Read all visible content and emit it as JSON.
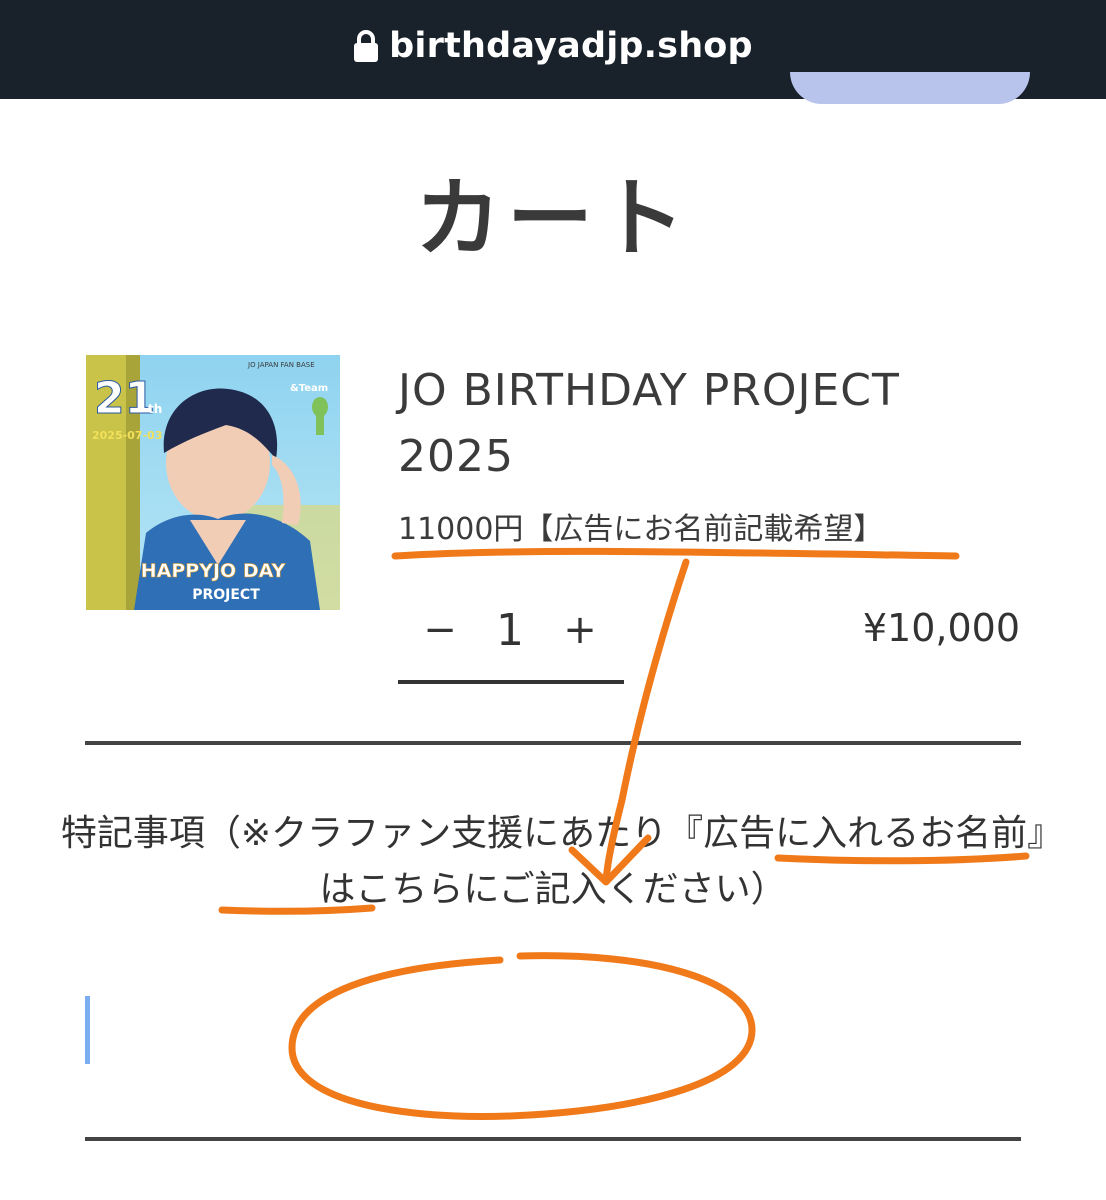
{
  "browser": {
    "url": "birthdayadjp.shop",
    "lock_icon": "lock-icon"
  },
  "page": {
    "title": "カート"
  },
  "cart_item": {
    "thumbnail": {
      "number": "21",
      "suffix": "th",
      "date": "2025-07-03",
      "fanbase": "JO JAPAN FAN BASE",
      "brand": "&Team",
      "line1": "HAPPYJO DAY",
      "line2": "PROJECT"
    },
    "name": "JO BIRTHDAY PROJECT 2025",
    "variant": "11000円【広告にお名前記載希望】",
    "quantity": "1",
    "minus_symbol": "−",
    "plus_symbol": "+",
    "price": "¥10,000"
  },
  "notes": {
    "label": "特記事項（※クラファン支援にあたり『広告に入れるお名前』はこちらにご記入ください）",
    "value": ""
  },
  "colors": {
    "topbar": "#19222b",
    "annotation": "#f07a1a",
    "caret": "#7aaef0",
    "pill": "#b9c4ec"
  }
}
